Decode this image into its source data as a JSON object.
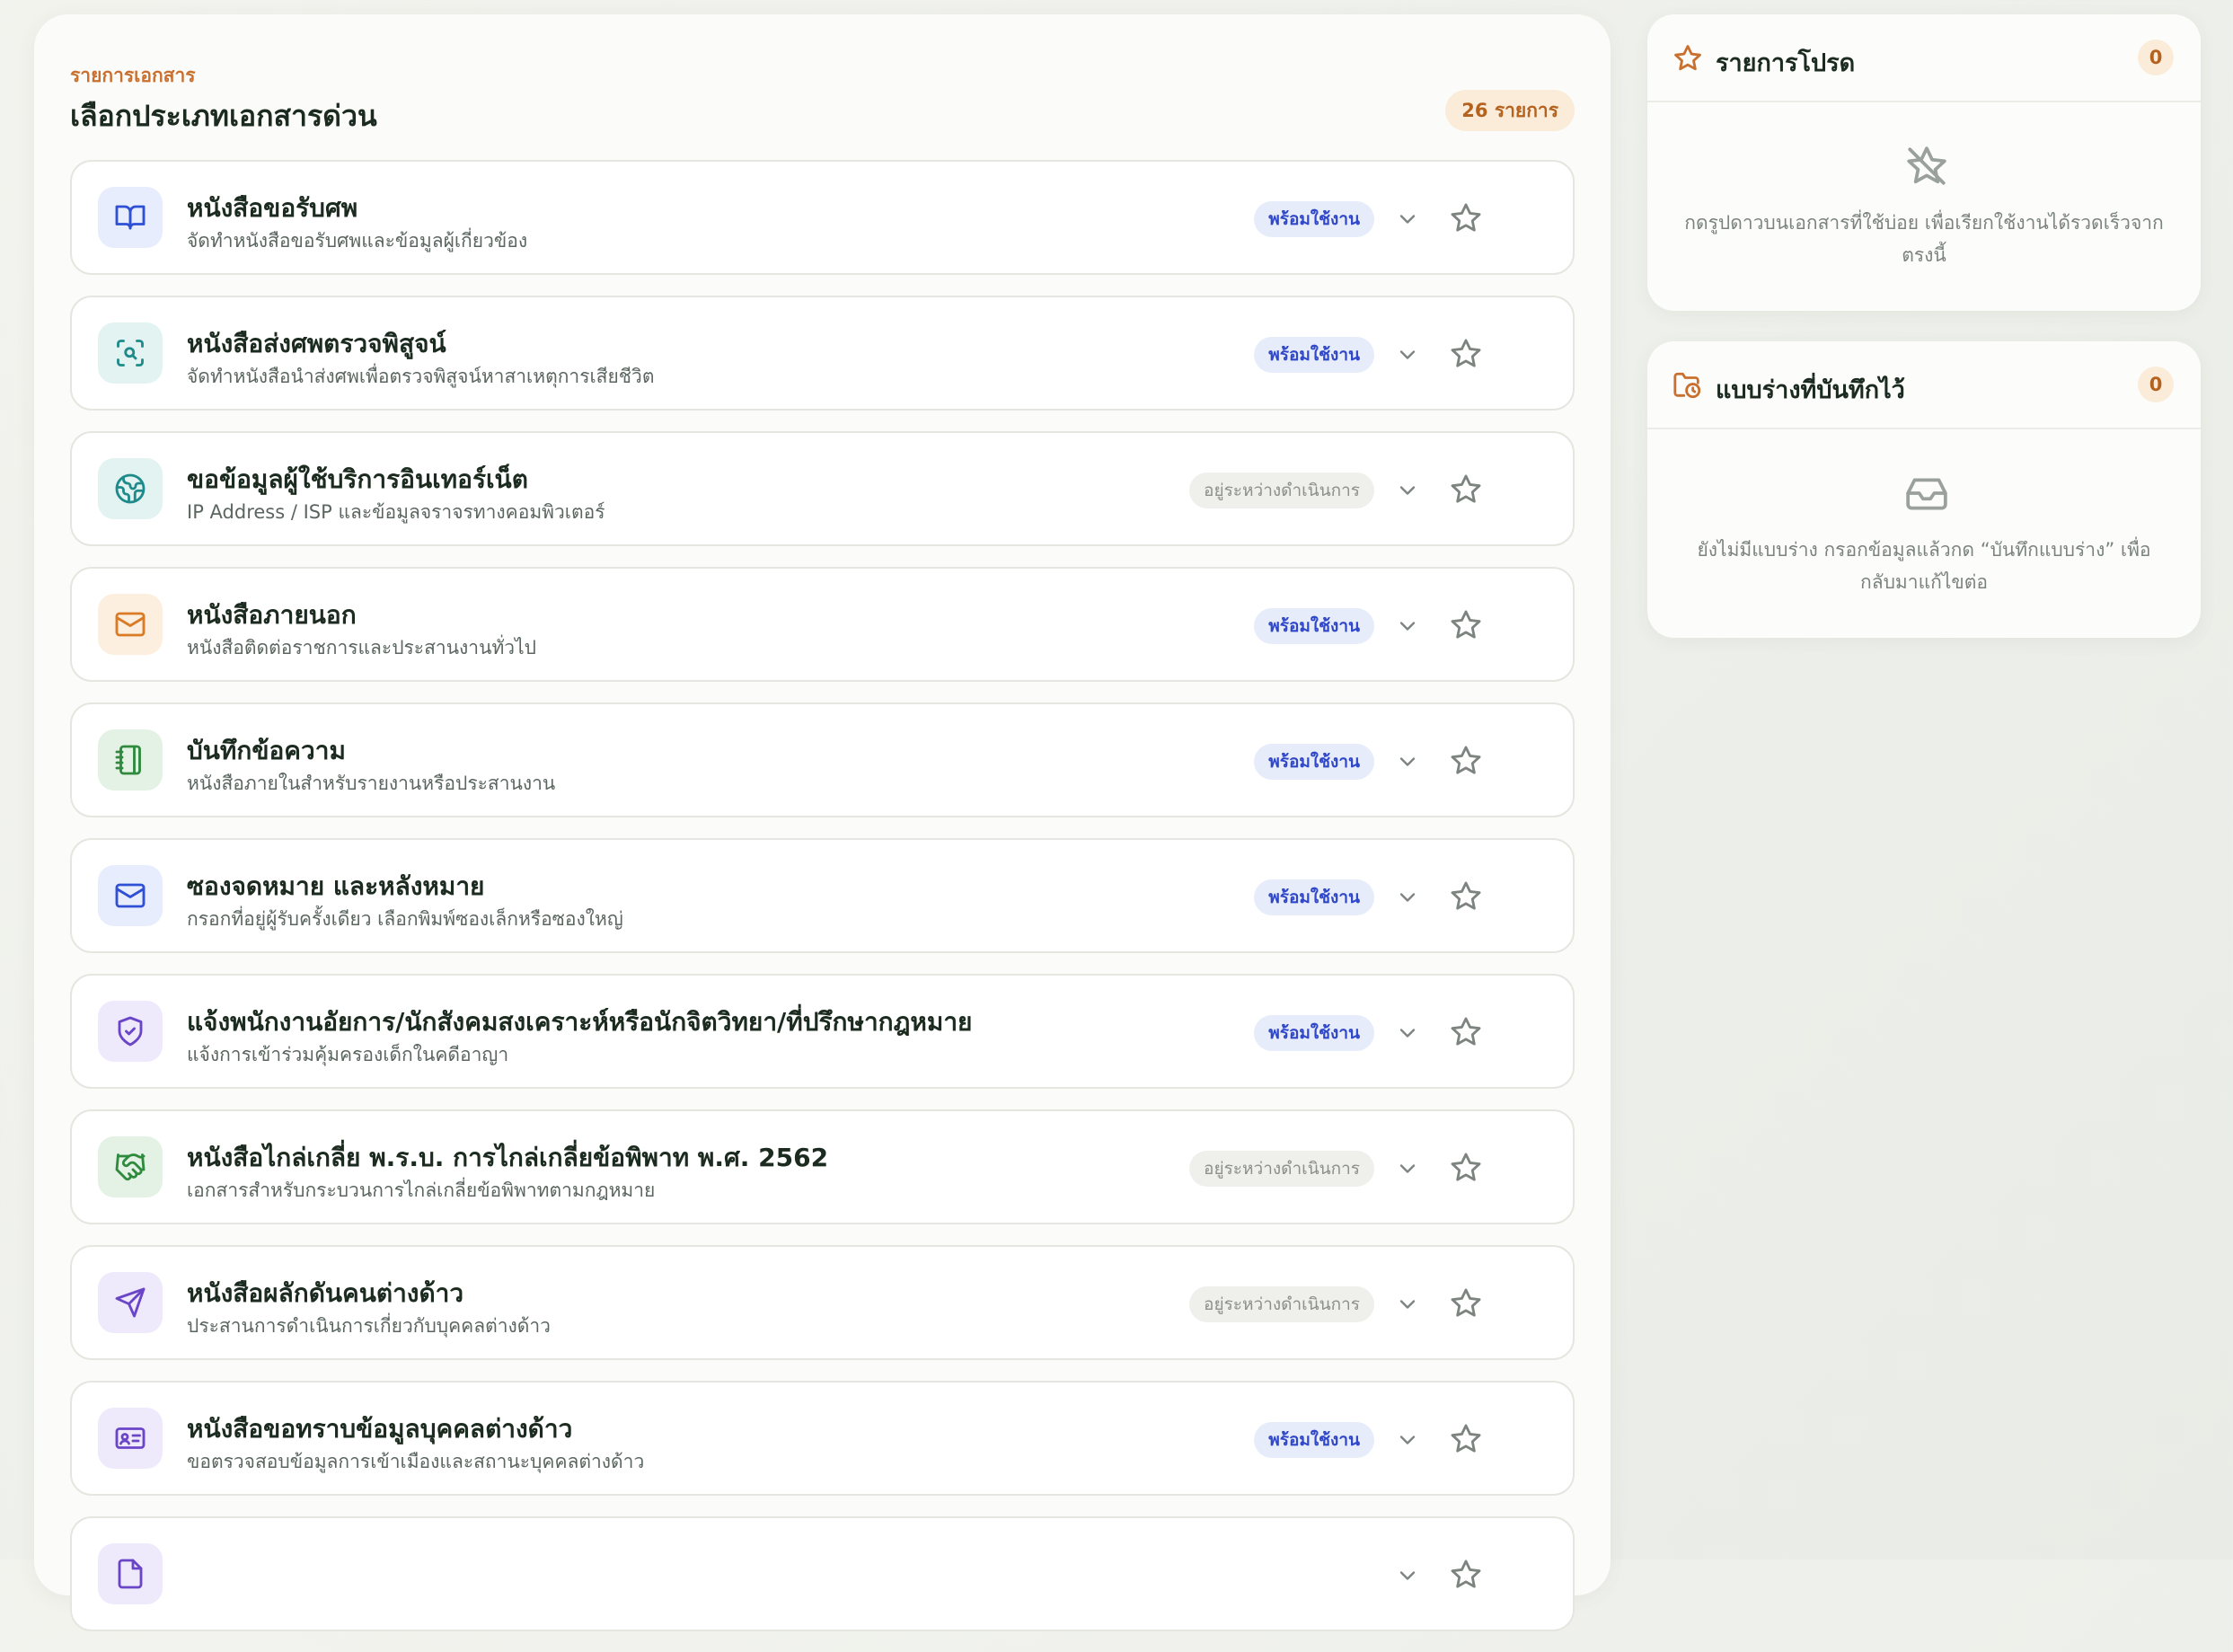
{
  "header": {
    "eyebrow": "รายการเอกสาร",
    "title": "เลือกประเภทเอกสารด่วน",
    "count": "26 รายการ"
  },
  "documents": [
    {
      "title": "หนังสือขอรับศพ",
      "desc": "จัดทำหนังสือขอรับศพและข้อมูลผู้เกี่ยวข้อง",
      "status": "พร้อมใช้งาน",
      "icon": "book-open-icon",
      "color": "#2f4fd4",
      "bg": "#e7edfc"
    },
    {
      "title": "หนังสือส่งศพตรวจพิสูจน์",
      "desc": "จัดทำหนังสือนำส่งศพเพื่อตรวจพิสูจน์หาสาเหตุการเสียชีวิต",
      "status": "พร้อมใช้งาน",
      "icon": "scan-search-icon",
      "color": "#1e8a8a",
      "bg": "#e2f3f2"
    },
    {
      "title": "ขอข้อมูลผู้ใช้บริการอินเทอร์เน็ต",
      "desc": "IP Address / ISP และข้อมูลจราจรทางคอมพิวเตอร์",
      "status": "อยู่ระหว่างดำเนินการ",
      "icon": "globe-icon",
      "color": "#1e8a8a",
      "bg": "#e2f3f2"
    },
    {
      "title": "หนังสือภายนอก",
      "desc": "หนังสือติดต่อราชการและประสานงานทั่วไป",
      "status": "พร้อมใช้งาน",
      "icon": "mail-icon",
      "color": "#d97a25",
      "bg": "#fcefdf"
    },
    {
      "title": "บันทึกข้อความ",
      "desc": "หนังสือภายในสำหรับรายงานหรือประสานงาน",
      "status": "พร้อมใช้งาน",
      "icon": "notebook-icon",
      "color": "#2f8a3e",
      "bg": "#e4f2e5"
    },
    {
      "title": "ซองจดหมาย และหลังหมาย",
      "desc": "กรอกที่อยู่ผู้รับครั้งเดียว เลือกพิมพ์ซองเล็กหรือซองใหญ่",
      "status": "พร้อมใช้งาน",
      "icon": "mail-icon",
      "color": "#2f4fd4",
      "bg": "#e7edfc"
    },
    {
      "title": "แจ้งพนักงานอัยการ/นักสังคมสงเคราะห์หรือนักจิตวิทยา/ที่ปรึกษากฎหมาย",
      "desc": "แจ้งการเข้าร่วมคุ้มครองเด็กในคดีอาญา",
      "status": "พร้อมใช้งาน",
      "icon": "shield-check-icon",
      "color": "#6a45c8",
      "bg": "#eee9fb"
    },
    {
      "title": "หนังสือไกล่เกลี่ย พ.ร.บ. การไกล่เกลี่ยข้อพิพาท พ.ศ. 2562",
      "desc": "เอกสารสำหรับกระบวนการไกล่เกลี่ยข้อพิพาทตามกฎหมาย",
      "status": "อยู่ระหว่างดำเนินการ",
      "icon": "handshake-icon",
      "color": "#2f8a3e",
      "bg": "#e4f2e5"
    },
    {
      "title": "หนังสือผลักดันคนต่างด้าว",
      "desc": "ประสานการดำเนินการเกี่ยวกับบุคคลต่างด้าว",
      "status": "อยู่ระหว่างดำเนินการ",
      "icon": "send-icon",
      "color": "#6a45c8",
      "bg": "#eee9fb"
    },
    {
      "title": "หนังสือขอทราบข้อมูลบุคคลต่างด้าว",
      "desc": "ขอตรวจสอบข้อมูลการเข้าเมืองและสถานะบุคคลต่างด้าว",
      "status": "พร้อมใช้งาน",
      "icon": "id-card-icon",
      "color": "#6a45c8",
      "bg": "#eee9fb"
    },
    {
      "title": "",
      "desc": "",
      "status": "",
      "icon": "file-icon",
      "color": "#6a45c8",
      "bg": "#eee9fb"
    }
  ],
  "favorites": {
    "title": "รายการโปรด",
    "count": "0",
    "empty_text": "กดรูปดาวบนเอกสารที่ใช้บ่อย เพื่อเรียกใช้งานได้รวดเร็วจากตรงนี้"
  },
  "drafts": {
    "title": "แบบร่างที่บันทึกไว้",
    "count": "0",
    "empty_text": "ยังไม่มีแบบร่าง กรอกข้อมูลแล้วกด “บันทึกแบบร่าง” เพื่อกลับมาแก้ไขต่อ"
  },
  "colors": {
    "accent": "#c9702e",
    "ready_badge": "#3048c8",
    "pending_badge": "#8c9089"
  }
}
